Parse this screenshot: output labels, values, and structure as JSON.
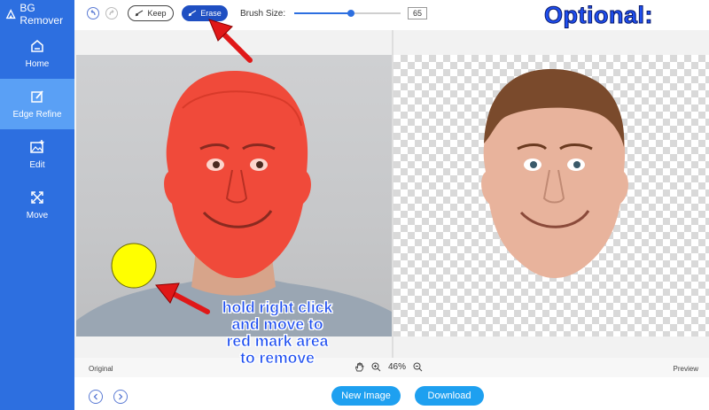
{
  "app": {
    "title": "BG Remover"
  },
  "sidebar": {
    "items": [
      {
        "label": "Home",
        "icon": "home-icon"
      },
      {
        "label": "Edge Refine",
        "icon": "edge-refine-icon",
        "active": true
      },
      {
        "label": "Edit",
        "icon": "edit-image-icon"
      },
      {
        "label": "Move",
        "icon": "move-icon"
      }
    ]
  },
  "toolbar": {
    "keep_label": "Keep",
    "erase_label": "Erase",
    "brush_size_label": "Brush Size:",
    "brush_size_value": "65"
  },
  "annotations": {
    "heading": "Optional:",
    "instruction_lines": [
      "hold right click",
      "and move to",
      "red mark area",
      "to remove"
    ]
  },
  "statusbar": {
    "original_label": "Original",
    "zoom_value": "46%",
    "preview_label": "Preview"
  },
  "footer": {
    "new_image_label": "New Image",
    "download_label": "Download"
  },
  "colors": {
    "sidebar": "#2d6fe0",
    "sidebar_active": "#5aa0f5",
    "erase_button": "#1f4fc2",
    "footer_buttons": "#1ea0f0",
    "brush_mask": "#f04a3a",
    "annotation_text": "#1f4ff0",
    "arrow": "#e01818",
    "brush_cursor": "#ffff00"
  }
}
